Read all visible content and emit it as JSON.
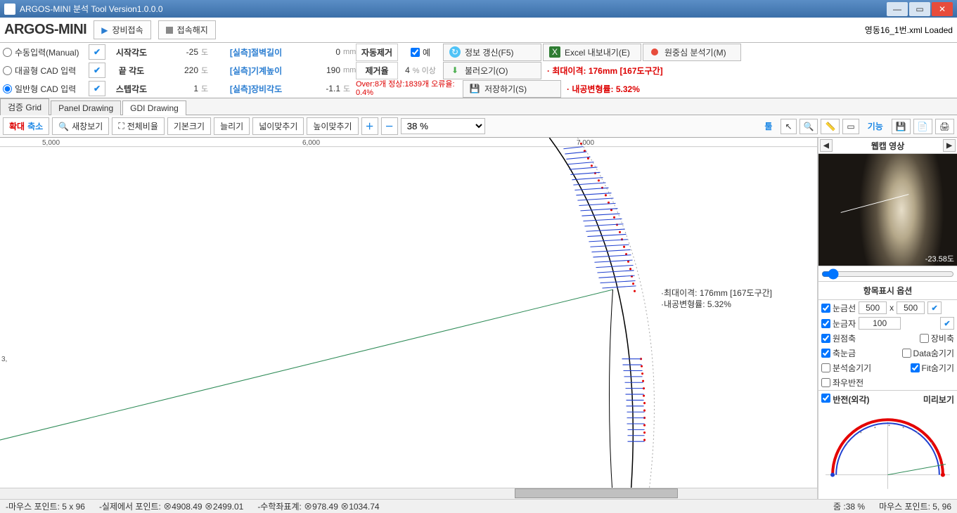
{
  "titlebar": {
    "title": "ARGOS-MINI 분석 Tool Version1.0.0.0"
  },
  "header": {
    "logo": "ARGOS-MINI",
    "btn_connect": "장비접속",
    "btn_disconnect": "접속해지",
    "loaded": "영동16_1번.xml Loaded"
  },
  "input_modes": {
    "manual": "수동입력(Manual)",
    "symmetric_cad": "대골형 CAD 입력",
    "general_cad": "일반형 CAD 입력"
  },
  "angles": {
    "start_lbl": "시작각도",
    "start_val": "-25",
    "start_unit": "도",
    "end_lbl": "끝 각도",
    "end_val": "220",
    "end_unit": "도",
    "step_lbl": "스텝각도",
    "step_val": "1",
    "step_unit": "도"
  },
  "measures": {
    "cut_lbl": "[실측]절벽길이",
    "cut_val": "0",
    "cut_unit": "mm",
    "machine_lbl": "[실측]기계높이",
    "machine_val": "190",
    "machine_unit": "mm",
    "device_lbl": "[실측]장비각도",
    "device_val": "-1.1",
    "device_unit": "도"
  },
  "auto": {
    "auto_remove_lbl": "자동제거",
    "yes_lbl": "예",
    "remove_rate_lbl": "제거율",
    "remove_rate_val": "4",
    "remove_rate_unit": "% 이상",
    "over_text": "Over:8개 정상:1839개 오류율: 0.4%"
  },
  "actions": {
    "refresh": "정보 갱신(F5)",
    "excel": "Excel 내보내기(E)",
    "analyze": "원중심 분석기(M)",
    "load": "불러오기(O)",
    "save": "저장하기(S)"
  },
  "status": {
    "max_deviation": "· 최대이격: 176mm  [167도구간]",
    "tunnel_deform": "· 내공변형률: 5.32%"
  },
  "tabs": {
    "grid": "검증 Grid",
    "panel": "Panel Drawing",
    "gdi": "GDI Drawing"
  },
  "toolbar": {
    "zoomin": "확대",
    "zoomout": "축소",
    "newwin": "새창보기",
    "fullfit": "전체비율",
    "origsize": "기본크기",
    "stretch": "늘리기",
    "fitw": "넓이맞추기",
    "fith": "높이맞추기",
    "zoom_val": "38 %",
    "tools": "툴",
    "function": "기능"
  },
  "canvas": {
    "ruler_5000": "5,000",
    "ruler_6000": "6,000",
    "ruler_7000": "7,000",
    "y_3": "3,",
    "annot1": "·최대이격:  176mm  [167도구간]",
    "annot2": "·내공변형률: 5.32%"
  },
  "rightpane": {
    "webcam_title": "웹캡 영상",
    "webcam_coord": "-23.58도",
    "options_title": "항목표시 옵션",
    "grid_line": "눈금선",
    "grid_x": "500",
    "grid_x_sep": "x",
    "grid_y": "500",
    "grid_ruler": "눈금자",
    "grid_ruler_val": "100",
    "origin_axis": "원점축",
    "device_axis": "장비축",
    "axis_scale": "축눈금",
    "data_hide": "Data숨기기",
    "analysis_hide": "분석숨기기",
    "fit_hide": "Fit숨기기",
    "lr_flip": "좌우반전",
    "invert_outer": "반전(외각)",
    "preview": "미리보기"
  },
  "statusbar": {
    "mouse": "-마우스 포인트: 5 x 96",
    "real": "-실제에서 포인트: ⊗4908.49 ⊗2499.01",
    "math": "-수학좌표계: ⊗978.49 ⊗1034.74",
    "zoom": "줌 :38 %",
    "mouse2": "마우스 포인트: 5, 96"
  }
}
